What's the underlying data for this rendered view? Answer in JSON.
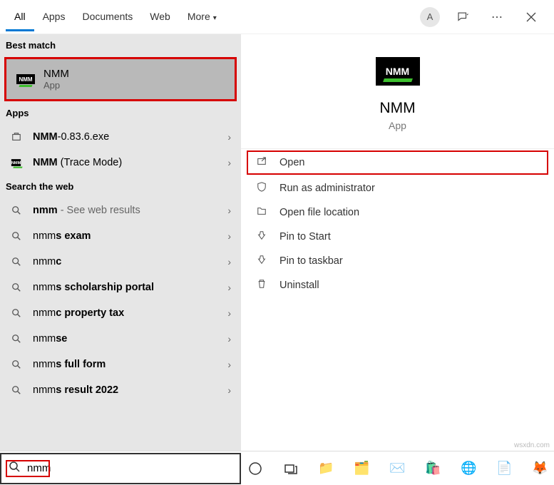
{
  "tabs": {
    "all": "All",
    "apps": "Apps",
    "documents": "Documents",
    "web": "Web",
    "more": "More"
  },
  "avatar_letter": "A",
  "sections": {
    "best_match": "Best match",
    "apps": "Apps",
    "web": "Search the web"
  },
  "best_match": {
    "title": "NMM",
    "sub": "App"
  },
  "apps_list": [
    {
      "html": "<b>NMM</b>-0.83.6.exe"
    },
    {
      "html": "<b>NMM</b> (Trace Mode)"
    }
  ],
  "web_list": [
    {
      "html": "<b>nmm</b> <span class='light'>- See web results</span>"
    },
    {
      "html": "nmm<b>s exam</b>"
    },
    {
      "html": "nmm<b>c</b>"
    },
    {
      "html": "nmm<b>s scholarship portal</b>"
    },
    {
      "html": "nmm<b>c property tax</b>"
    },
    {
      "html": "nmm<b>se</b>"
    },
    {
      "html": "nmm<b>s full form</b>"
    },
    {
      "html": "nmm<b>s result 2022</b>"
    }
  ],
  "detail": {
    "title": "NMM",
    "sub": "App"
  },
  "actions": {
    "open": "Open",
    "run_admin": "Run as administrator",
    "open_loc": "Open file location",
    "pin_start": "Pin to Start",
    "pin_taskbar": "Pin to taskbar",
    "uninstall": "Uninstall"
  },
  "search_value": "nmm",
  "watermark": "wsxdn.com"
}
